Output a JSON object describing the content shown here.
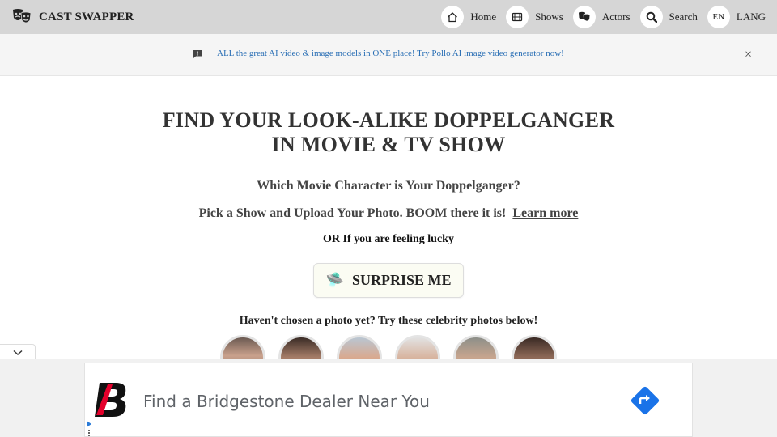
{
  "header": {
    "brand": "CAST SWAPPER",
    "nav": [
      {
        "label": "Home",
        "icon": "home-icon"
      },
      {
        "label": "Shows",
        "icon": "film-icon"
      },
      {
        "label": "Actors",
        "icon": "masks-icon"
      },
      {
        "label": "Search",
        "icon": "search-icon"
      },
      {
        "label": "LANG",
        "badge": "EN",
        "icon": "language-badge"
      }
    ]
  },
  "banner": {
    "text": "ALL the great AI video & image models in ONE place! Try Pollo AI image video generator now!",
    "close": "×"
  },
  "main": {
    "title_line1": "FIND YOUR LOOK-ALIKE DOPPELGANGER",
    "title_line2": "IN MOVIE & TV SHOW",
    "subtitle": "Which Movie Character is Your Doppelganger?",
    "pick_text": "Pick a Show and Upload Your Photo. BOOM there it is!",
    "learn_more": "Learn more",
    "lucky": "OR If you are feeling lucky",
    "surprise_icon": "🛸",
    "surprise_label": "SURPRISE ME",
    "celeb_hint": "Haven't chosen a photo yet? Try these celebrity photos below!"
  },
  "ad": {
    "text": "Find a Bridgestone Dealer Near You"
  },
  "colors": {
    "header_bg": "#d6d6d6",
    "banner_link": "#2a6fb5",
    "ad_brand_red": "#e4002b",
    "ad_arrow_blue": "#1a73e8"
  }
}
